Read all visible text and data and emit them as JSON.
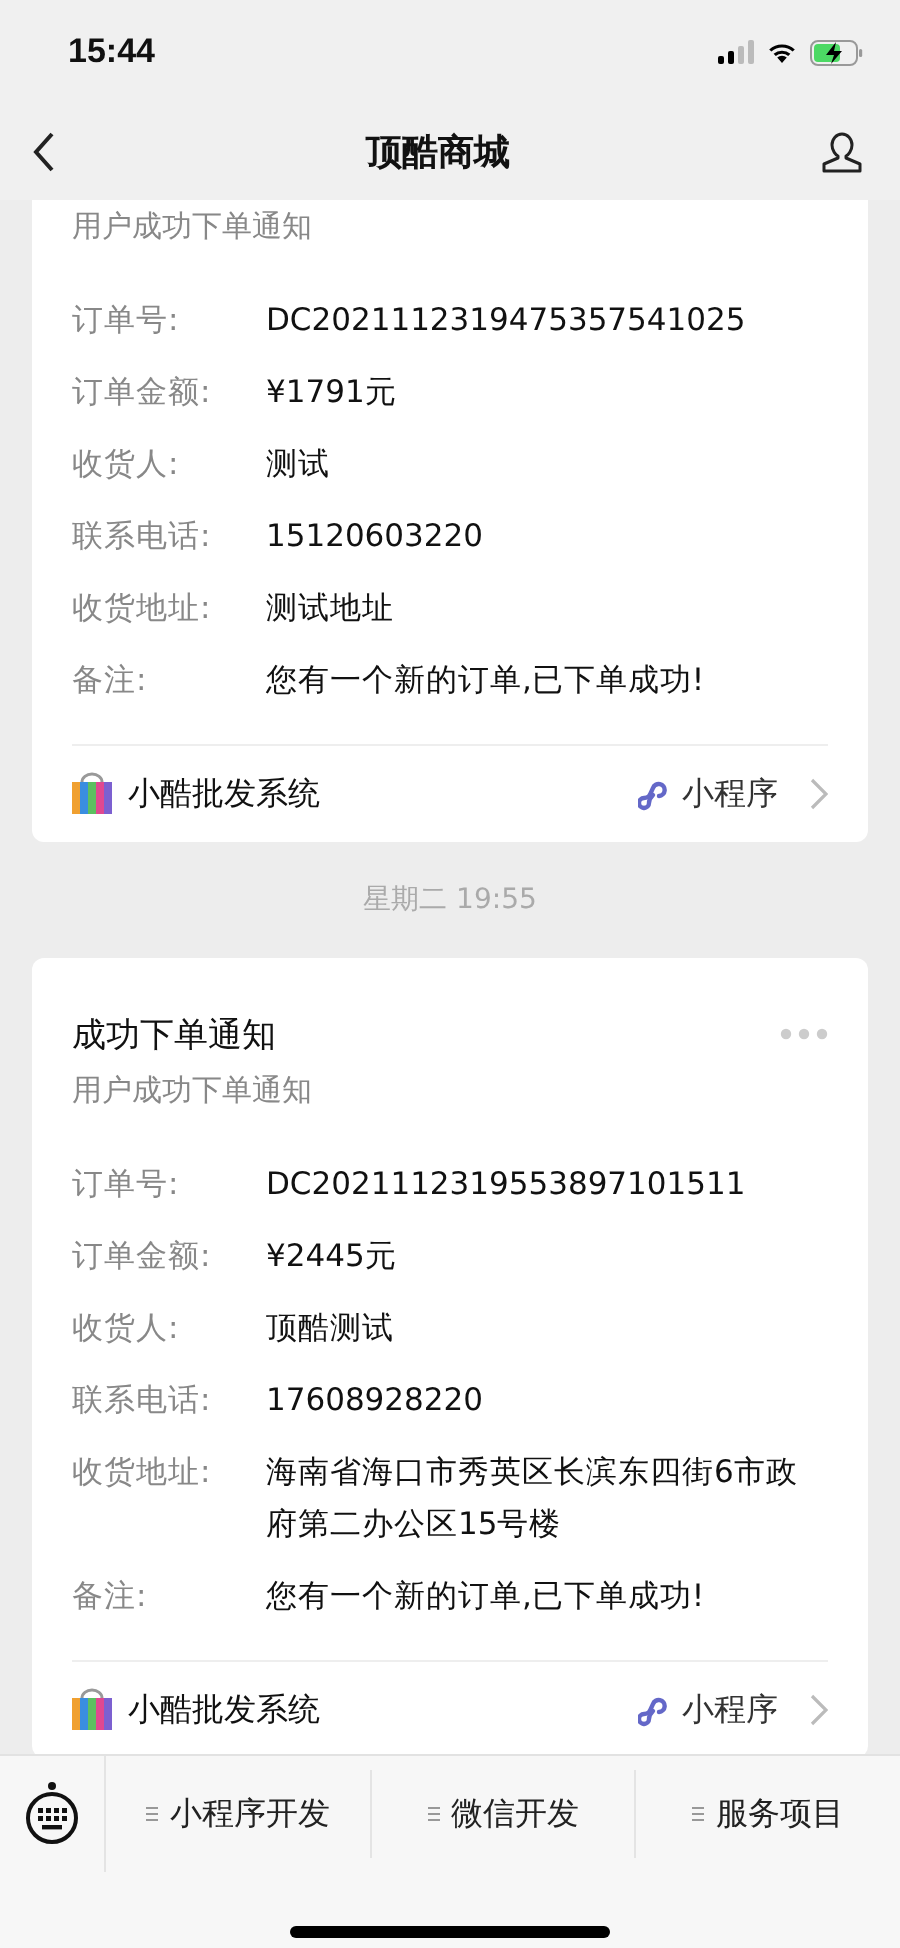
{
  "status_bar": {
    "time": "15:44"
  },
  "nav": {
    "title": "顶酷商城"
  },
  "messages": [
    {
      "kind": "card",
      "subtitle": "用户成功下单通知",
      "fields": [
        {
          "label": "订单号:",
          "value": "DC2021112319475357541025"
        },
        {
          "label": "订单金额:",
          "value": "¥1791元"
        },
        {
          "label": "收货人:",
          "value": "测试"
        },
        {
          "label": "联系电话:",
          "value": "15120603220"
        },
        {
          "label": "收货地址:",
          "value": "测试地址"
        },
        {
          "label": "备注:",
          "value": "您有一个新的订单,已下单成功!"
        }
      ],
      "app_name": "小酷批发系统",
      "app_tag": "小程序"
    },
    {
      "kind": "time",
      "text": "星期二 19:55"
    },
    {
      "kind": "card",
      "title": "成功下单通知",
      "subtitle": "用户成功下单通知",
      "fields": [
        {
          "label": "订单号:",
          "value": "DC2021112319553897101511"
        },
        {
          "label": "订单金额:",
          "value": "¥2445元"
        },
        {
          "label": "收货人:",
          "value": "顶酷测试"
        },
        {
          "label": "联系电话:",
          "value": "17608928220"
        },
        {
          "label": "收货地址:",
          "value": "海南省海口市秀英区长滨东四街6市政府第二办公区15号楼"
        },
        {
          "label": "备注:",
          "value": "您有一个新的订单,已下单成功!"
        }
      ],
      "app_name": "小酷批发系统",
      "app_tag": "小程序"
    }
  ],
  "menu": [
    "小程序开发",
    "微信开发",
    "服务项目"
  ]
}
